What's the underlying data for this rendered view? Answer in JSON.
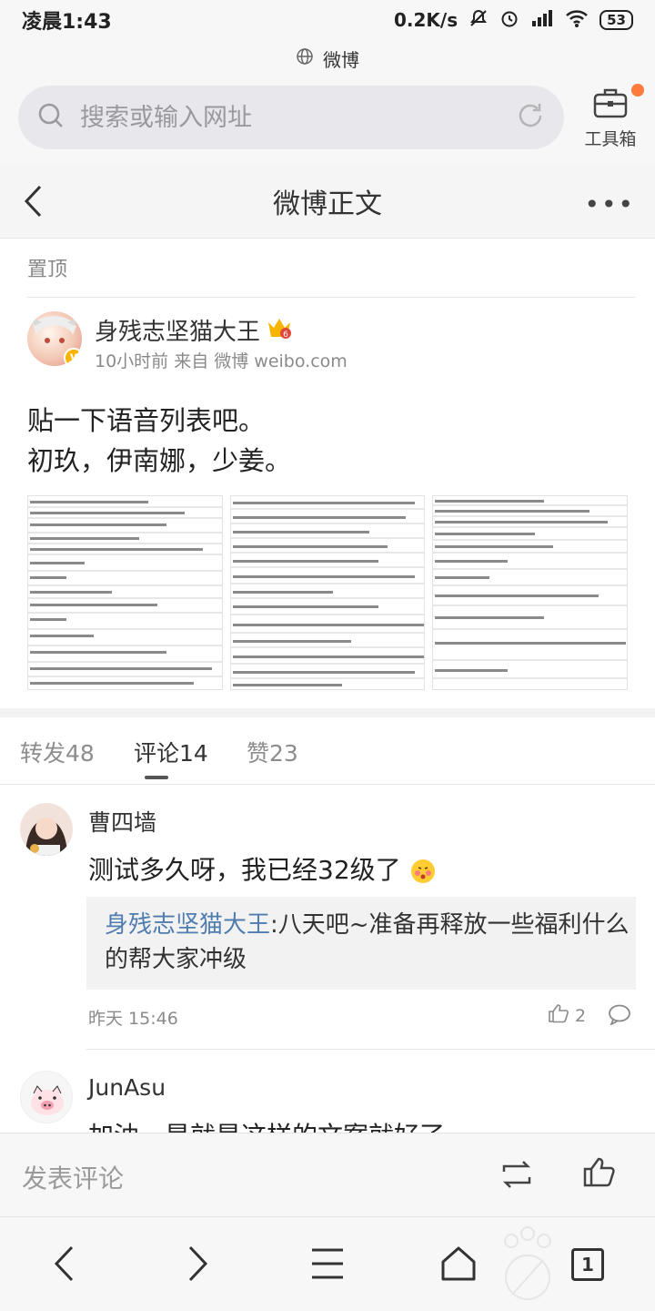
{
  "status_bar": {
    "time": "凌晨1:43",
    "speed": "0.2K/s",
    "battery": "53"
  },
  "browser": {
    "site_title": "微博",
    "search_placeholder": "搜索或输入网址",
    "toolbox_label": "工具箱"
  },
  "page": {
    "title": "微博正文",
    "pinned_label": "置顶"
  },
  "post": {
    "author": "身残志坚猫大王",
    "meta": "10小时前 来自 微博 weibo.com",
    "text_lines": [
      "贴一下语音列表吧。",
      "初玖，伊南娜，少姜。"
    ],
    "images": [
      "voice-list-image-1",
      "voice-list-image-2",
      "voice-list-image-3"
    ]
  },
  "tabs": [
    {
      "label": "转发48"
    },
    {
      "label": "评论14"
    },
    {
      "label": "赞23"
    }
  ],
  "comments": [
    {
      "name": "曹四墙",
      "text": "测试多久呀，我已经32级了",
      "reply_author": "身残志坚猫大王",
      "reply_line1": ":八天吧~准备再释放一些福利什么",
      "reply_line2": "的帮大家冲级",
      "time": "昨天 15:46",
      "likes": "2"
    },
    {
      "name": "JunAsu",
      "text": "加油，是就是这样的文案就好了"
    }
  ],
  "composer": {
    "placeholder": "发表评论"
  },
  "nav": {
    "tab_count": "1"
  },
  "colors": {
    "accent_orange": "#ff7a3d",
    "link_blue": "#507daf",
    "vip_gold": "#f7b500"
  }
}
